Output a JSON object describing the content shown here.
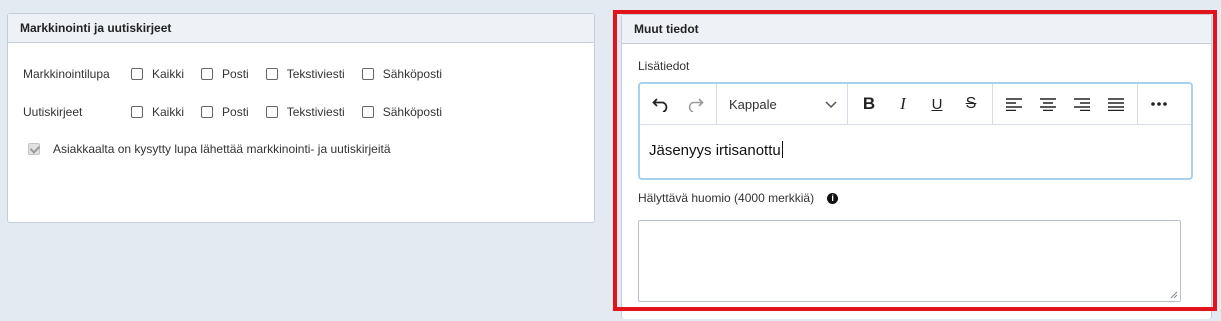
{
  "left_panel": {
    "title": "Markkinointi ja uutiskirjeet",
    "rows": [
      {
        "label": "Markkinointilupa",
        "options": [
          "Kaikki",
          "Posti",
          "Tekstiviesti",
          "Sähköposti"
        ]
      },
      {
        "label": "Uutiskirjeet",
        "options": [
          "Kaikki",
          "Posti",
          "Tekstiviesti",
          "Sähköposti"
        ]
      }
    ],
    "consent_label": "Asiakkaalta on kysytty lupa lähettää markkinointi- ja uutiskirjeitä",
    "consent_checked": true
  },
  "right_panel": {
    "title": "Muut tiedot",
    "lisatiedot_label": "Lisätiedot",
    "editor": {
      "format_select": "Kappale",
      "content": "Jäsenyys irtisanottu",
      "toolbar_icons": [
        "undo-icon",
        "redo-icon",
        "bold-icon",
        "italic-icon",
        "underline-icon",
        "strikethrough-icon",
        "align-left-icon",
        "align-center-icon",
        "align-right-icon",
        "align-justify-icon",
        "more-icon"
      ]
    },
    "huomio_label": "Hälyttävä huomio (4000 merkkiä)",
    "huomio_value": ""
  },
  "highlight_color": "#e3131b"
}
